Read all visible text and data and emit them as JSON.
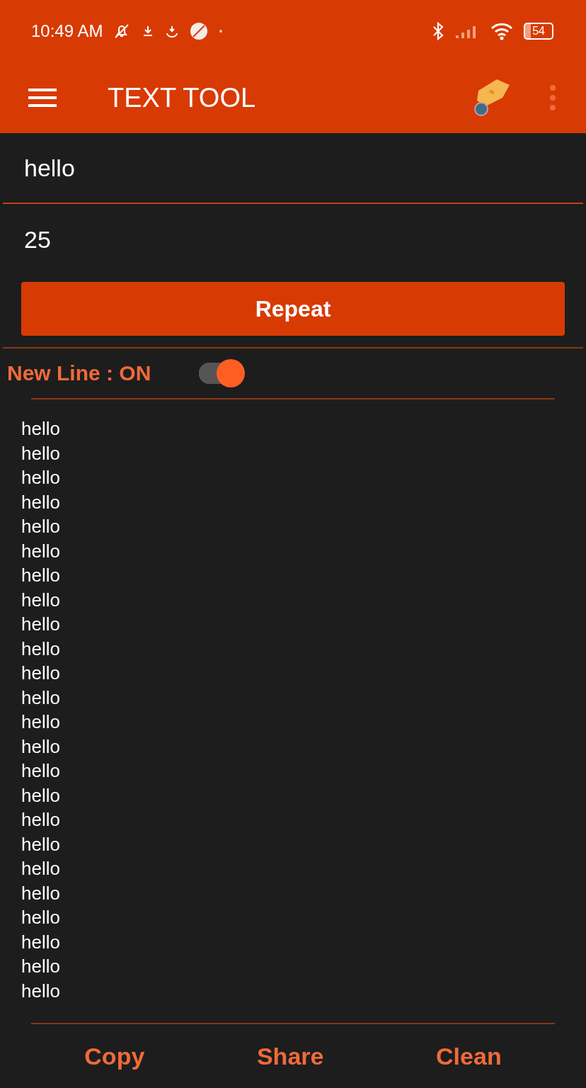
{
  "status_bar": {
    "time": "10:49 AM",
    "battery": "54"
  },
  "app_bar": {
    "title": "TEXT TOOL"
  },
  "text_field": {
    "value": "hello"
  },
  "count_field": {
    "value": "25"
  },
  "repeat_button": {
    "label": "Repeat"
  },
  "new_line": {
    "label": "New Line : ON",
    "on": true
  },
  "output_lines": [
    "hello",
    "hello",
    "hello",
    "hello",
    "hello",
    "hello",
    "hello",
    "hello",
    "hello",
    "hello",
    "hello",
    "hello",
    "hello",
    "hello",
    "hello",
    "hello",
    "hello",
    "hello",
    "hello",
    "hello",
    "hello",
    "hello",
    "hello",
    "hello"
  ],
  "actions": [
    "Copy",
    "Share",
    "Clean"
  ]
}
